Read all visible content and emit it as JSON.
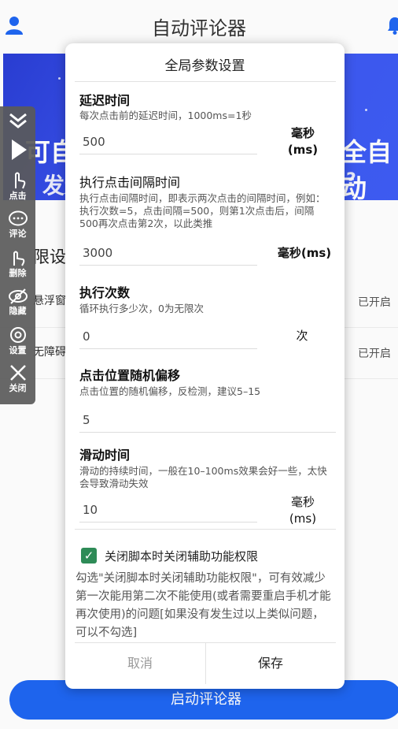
{
  "app": {
    "title": "自动评论器"
  },
  "banner": {
    "left_line1": "可自",
    "left_line2": "发送,",
    "right_line1": "全自动",
    "right_line2": "?"
  },
  "permissions": {
    "section_title": "限设置",
    "rows": [
      {
        "label": "悬浮窗",
        "status": "已开启"
      },
      {
        "label": "无障碍",
        "status": "已开启"
      }
    ]
  },
  "start_button": "启动评论器",
  "toolbar": {
    "items": [
      {
        "label": ""
      },
      {
        "label": ""
      },
      {
        "label": "点击"
      },
      {
        "label": "评论"
      },
      {
        "label": "删除"
      },
      {
        "label": "隐藏"
      },
      {
        "label": "设置"
      },
      {
        "label": "关闭"
      }
    ]
  },
  "dialog": {
    "title": "全局参数设置",
    "fields": [
      {
        "title": "延迟时间",
        "desc": "每次点击前的延迟时间，1000ms=1秒",
        "value": "500",
        "unit": "毫秒\n(ms)"
      },
      {
        "title": "执行点击间隔时间",
        "desc": "执行点击间隔时间，即表示两次点击的间隔时间，例如：执行次数=5，点击间隔=500，则第1次点击后，间隔500再次点击第2次，以此类推",
        "value": "3000",
        "unit": "毫秒(ms)"
      },
      {
        "title": "执行次数",
        "desc": "循环执行多少次，0为无限次",
        "value": "0",
        "unit": "次"
      },
      {
        "title": "点击位置随机偏移",
        "desc": "点击位置的随机偏移，反检测，建议5–15",
        "value": "5",
        "unit": ""
      },
      {
        "title": "滑动时间",
        "desc": "滑动的持续时间，一般在10–100ms效果会好一些，太快会导致滑动失效",
        "value": "10",
        "unit": "毫秒\n(ms)"
      }
    ],
    "checkbox": {
      "checked": true,
      "label": "关闭脚本时关闭辅助功能权限"
    },
    "note": "勾选\"关闭脚本时关闭辅助功能权限\"，可有效减少第一次能用第二次不能使用(或者需要重启手机才能再次使用)的问题[如果没有发生过以上类似问题，可以不勾选]",
    "cancel_label": "取消",
    "save_label": "保存"
  },
  "colors": {
    "accent": "#1f66f2",
    "banner": "#3d56f0",
    "checkbox": "#2e8b57",
    "toolbar": "#5a5a5a"
  }
}
